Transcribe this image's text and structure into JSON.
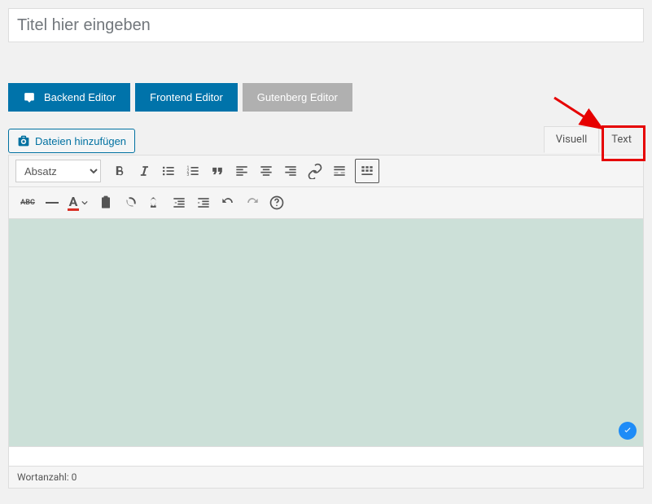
{
  "title": {
    "placeholder": "Titel hier eingeben"
  },
  "editorButtons": {
    "backend": "Backend Editor",
    "frontend": "Frontend Editor",
    "gutenberg": "Gutenberg Editor"
  },
  "mediaButton": "Dateien hinzufügen",
  "tabs": {
    "visual": "Visuell",
    "text": "Text"
  },
  "formatSelect": "Absatz",
  "wordCount": "Wortanzahl: 0"
}
